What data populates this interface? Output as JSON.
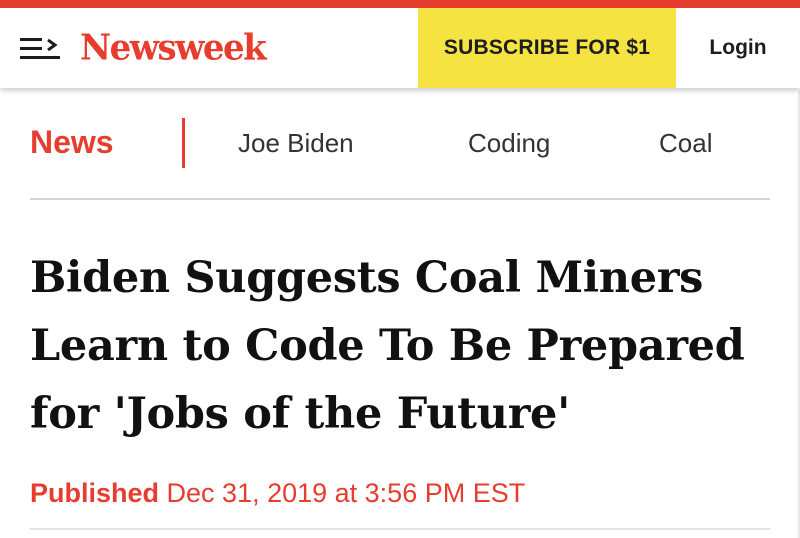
{
  "colors": {
    "brand_red": "#e63d2f",
    "subscribe_yellow": "#f5e342",
    "text_dark": "#111111",
    "nav_text": "#333333"
  },
  "header": {
    "menu_icon": "menu-arrow-icon",
    "logo_text": "Newsweek",
    "subscribe_label": "SUBSCRIBE FOR $1",
    "login_label": "Login"
  },
  "nav": {
    "section_label": "News",
    "links": [
      "Joe Biden",
      "Coding",
      "Coal"
    ]
  },
  "article": {
    "headline_lines": [
      "Biden Suggests Coal Miners",
      "Learn to Code To Be Prepared",
      "for 'Jobs of the Future'"
    ],
    "published_label": "Published",
    "published_date": "Dec 31, 2019 at 3:56 PM EST"
  }
}
